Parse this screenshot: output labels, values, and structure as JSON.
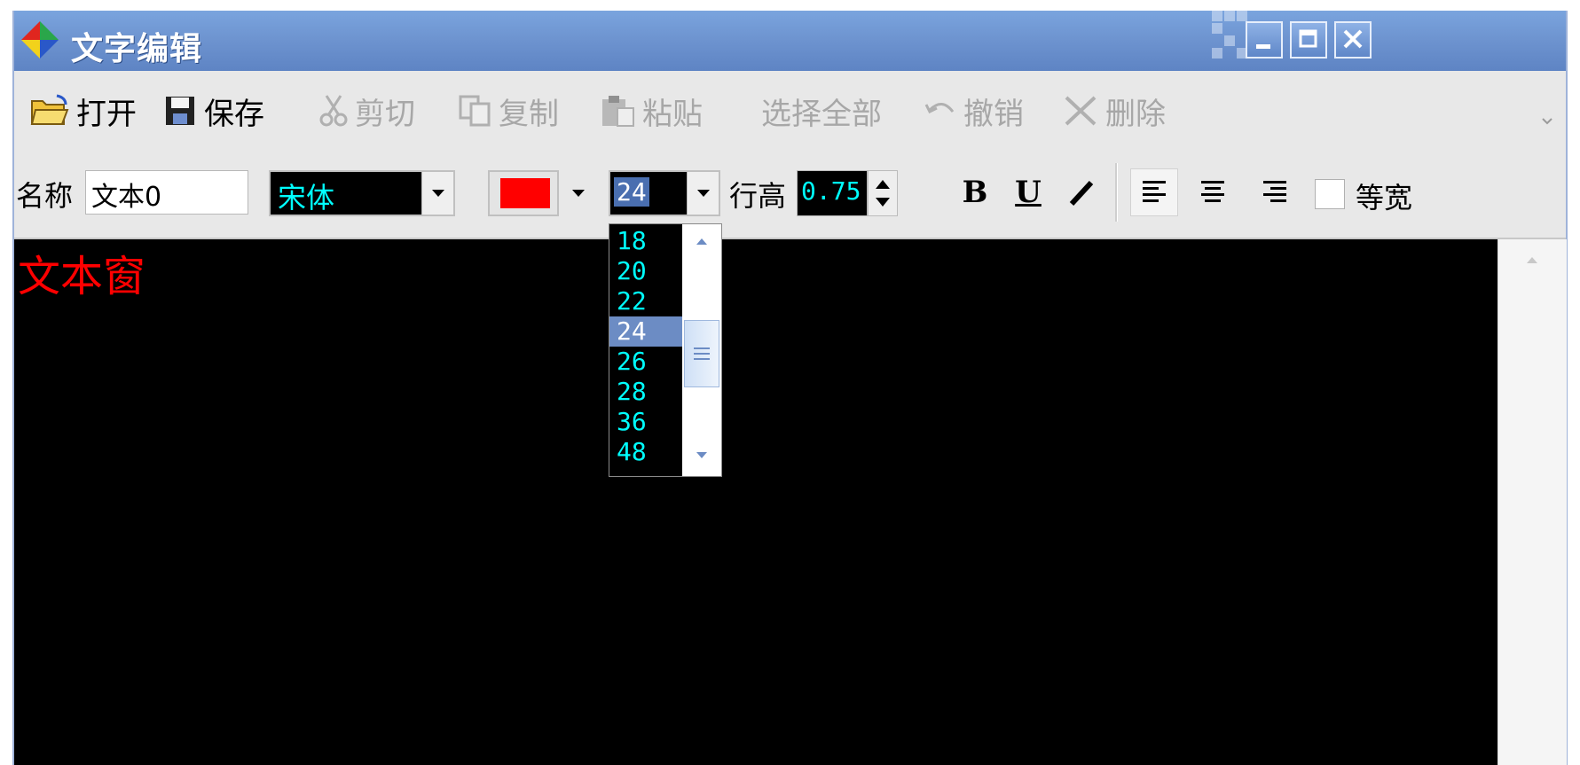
{
  "window": {
    "title": "文字编辑"
  },
  "toolbar": {
    "open": "打开",
    "save": "保存",
    "cut": "剪切",
    "copy": "复制",
    "paste": "粘贴",
    "select_all": "选择全部",
    "undo": "撤销",
    "delete": "删除"
  },
  "format_bar": {
    "name_label": "名称",
    "name_value": "文本0",
    "font_value": "宋体",
    "color": "#ff0000",
    "size_value": "24",
    "line_height_label": "行高",
    "line_height_value": "0.75",
    "bold": "B",
    "underline": "U",
    "monospace_label": "等宽"
  },
  "size_dropdown": {
    "options": [
      "18",
      "20",
      "22",
      "24",
      "26",
      "28",
      "36",
      "48"
    ],
    "selected": "24"
  },
  "editor": {
    "text": "文本窗",
    "text_color": "#ff0000",
    "background": "#000000"
  }
}
